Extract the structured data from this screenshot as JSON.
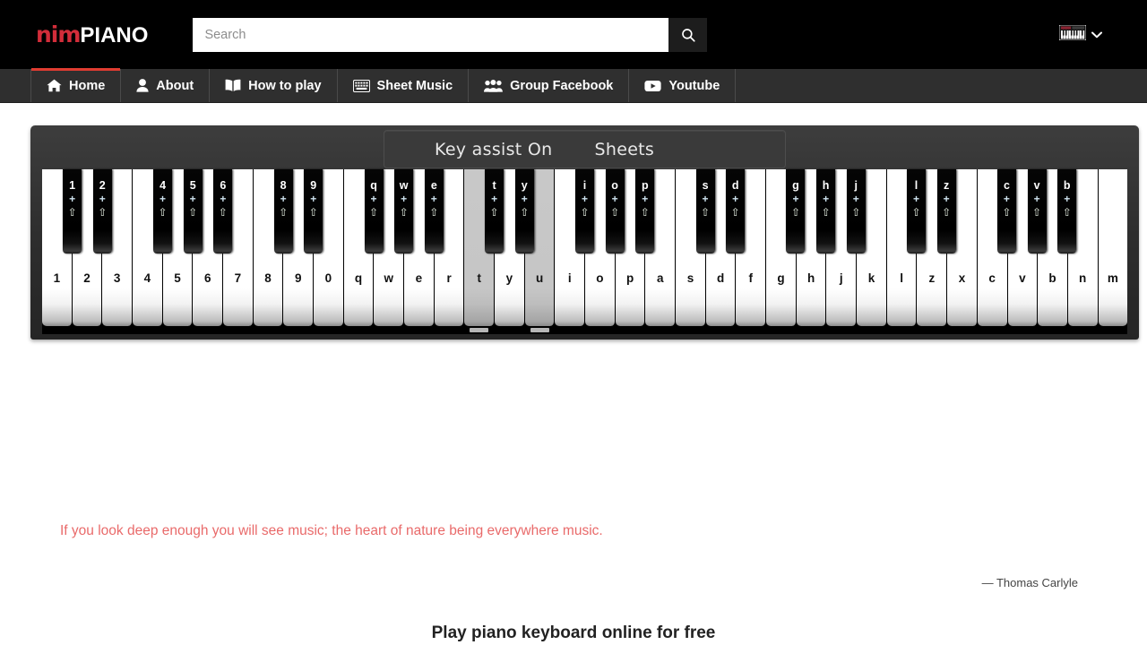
{
  "header": {
    "brand_prefix": "nim",
    "brand_suffix": "PIANO",
    "search": {
      "value": "",
      "placeholder": "Search",
      "button_icon": "search-icon"
    },
    "account_menu": {
      "icon": "piano-keyboard-icon",
      "chevron": "⌄"
    }
  },
  "nav": {
    "items": [
      {
        "label": "Home",
        "icon": "home-icon",
        "active": true
      },
      {
        "label": "About",
        "icon": "user-icon",
        "active": false
      },
      {
        "label": "How to play",
        "icon": "book-icon",
        "active": false
      },
      {
        "label": "Sheet Music",
        "icon": "keyboard-icon",
        "active": false
      },
      {
        "label": "Group Facebook",
        "icon": "users-icon",
        "active": false
      },
      {
        "label": "Youtube",
        "icon": "youtube-icon",
        "active": false
      }
    ]
  },
  "piano": {
    "toolbar": {
      "key_assist_label": "Key assist On",
      "sheets_label": "Sheets"
    },
    "white_keys": [
      {
        "label": "1",
        "pressed": false
      },
      {
        "label": "2",
        "pressed": false
      },
      {
        "label": "3",
        "pressed": false
      },
      {
        "label": "4",
        "pressed": false
      },
      {
        "label": "5",
        "pressed": false
      },
      {
        "label": "6",
        "pressed": false
      },
      {
        "label": "7",
        "pressed": false
      },
      {
        "label": "8",
        "pressed": false
      },
      {
        "label": "9",
        "pressed": false
      },
      {
        "label": "0",
        "pressed": false
      },
      {
        "label": "q",
        "pressed": false
      },
      {
        "label": "w",
        "pressed": false
      },
      {
        "label": "e",
        "pressed": false
      },
      {
        "label": "r",
        "pressed": false
      },
      {
        "label": "t",
        "pressed": true
      },
      {
        "label": "y",
        "pressed": false
      },
      {
        "label": "u",
        "pressed": true
      },
      {
        "label": "i",
        "pressed": false
      },
      {
        "label": "o",
        "pressed": false
      },
      {
        "label": "p",
        "pressed": false
      },
      {
        "label": "a",
        "pressed": false
      },
      {
        "label": "s",
        "pressed": false
      },
      {
        "label": "d",
        "pressed": false
      },
      {
        "label": "f",
        "pressed": false
      },
      {
        "label": "g",
        "pressed": false
      },
      {
        "label": "h",
        "pressed": false
      },
      {
        "label": "j",
        "pressed": false
      },
      {
        "label": "k",
        "pressed": false
      },
      {
        "label": "l",
        "pressed": false
      },
      {
        "label": "z",
        "pressed": false
      },
      {
        "label": "x",
        "pressed": false
      },
      {
        "label": "c",
        "pressed": false
      },
      {
        "label": "v",
        "pressed": false
      },
      {
        "label": "b",
        "pressed": false
      },
      {
        "label": "n",
        "pressed": false
      },
      {
        "label": "m",
        "pressed": false
      }
    ],
    "black_key_modifier_plus": "+",
    "black_key_modifier_shift": "⇧",
    "black_keys": [
      {
        "label": "1",
        "after_white_index": 0
      },
      {
        "label": "2",
        "after_white_index": 1
      },
      {
        "label": "4",
        "after_white_index": 3
      },
      {
        "label": "5",
        "after_white_index": 4
      },
      {
        "label": "6",
        "after_white_index": 5
      },
      {
        "label": "8",
        "after_white_index": 7
      },
      {
        "label": "9",
        "after_white_index": 8
      },
      {
        "label": "q",
        "after_white_index": 10
      },
      {
        "label": "w",
        "after_white_index": 11
      },
      {
        "label": "e",
        "after_white_index": 12
      },
      {
        "label": "t",
        "after_white_index": 14
      },
      {
        "label": "y",
        "after_white_index": 15
      },
      {
        "label": "i",
        "after_white_index": 17
      },
      {
        "label": "o",
        "after_white_index": 18
      },
      {
        "label": "p",
        "after_white_index": 19
      },
      {
        "label": "s",
        "after_white_index": 21
      },
      {
        "label": "d",
        "after_white_index": 22
      },
      {
        "label": "g",
        "after_white_index": 24
      },
      {
        "label": "h",
        "after_white_index": 25
      },
      {
        "label": "j",
        "after_white_index": 26
      },
      {
        "label": "l",
        "after_white_index": 28
      },
      {
        "label": "z",
        "after_white_index": 29
      },
      {
        "label": "c",
        "after_white_index": 31
      },
      {
        "label": "v",
        "after_white_index": 32
      },
      {
        "label": "b",
        "after_white_index": 33
      }
    ],
    "felt_marks_after_white_index": [
      14,
      16
    ]
  },
  "quote": {
    "text": "If you look deep enough you will see music; the heart of nature being everywhere music.",
    "attribution": "— Thomas Carlyle",
    "color": "#e96a6a"
  },
  "bottom_heading": "Play piano keyboard online for free",
  "colors": {
    "brand_red": "#d32d3a",
    "nav_background": "#2f2f2f",
    "topbar_background": "#000000",
    "active_indicator": "#e03c31",
    "piano_body": "#2d2d2d"
  }
}
